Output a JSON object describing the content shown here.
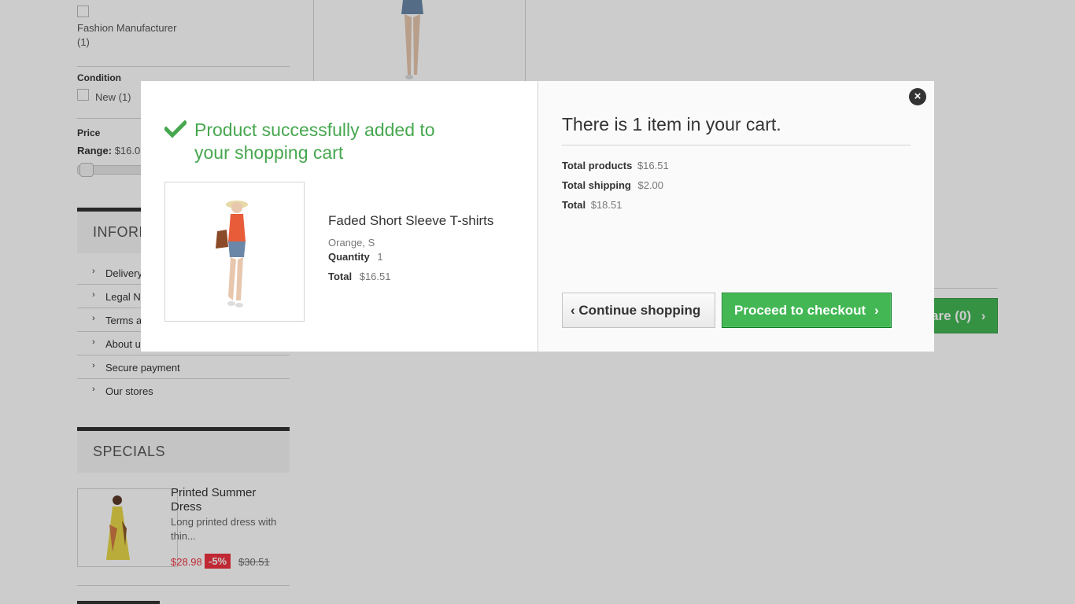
{
  "background": {
    "filters": {
      "manufacturer_label": "Fashion Manufacturer",
      "manufacturer_count": "(1)",
      "condition_title": "Condition",
      "condition_option": "New (1)",
      "price_title": "Price",
      "range_label": "Range:",
      "range_value": "$16.0"
    },
    "information": {
      "title": "INFORM",
      "items": [
        "Delivery",
        "Legal N",
        "Terms a",
        "About u",
        "Secure payment",
        "Our stores"
      ]
    },
    "specials": {
      "title": "SPECIALS",
      "product_name": "Printed Summer Dress",
      "description": "Long printed dress with thin...",
      "price": "$28.98",
      "discount": "-5%",
      "old_price": "$30.51"
    },
    "compare_button": "are (0)"
  },
  "modal": {
    "close_icon": "×",
    "left": {
      "success_message": "Product successfully added to your shopping cart",
      "product_name": "Faded Short Sleeve T-shirts",
      "attributes": "Orange, S",
      "quantity_label": "Quantity",
      "quantity_value": "1",
      "total_label": "Total",
      "total_value": "$16.51"
    },
    "right": {
      "cart_title": "There is 1 item in your cart.",
      "total_products_label": "Total products",
      "total_products_value": "$16.51",
      "total_shipping_label": "Total shipping",
      "total_shipping_value": "$2.00",
      "total_label": "Total",
      "total_value": "$18.51",
      "continue_button": "Continue shopping",
      "checkout_button": "Proceed to checkout"
    }
  },
  "colors": {
    "success_green": "#46a74e",
    "checkout_green": "#43b754",
    "sale_red": "#f13340"
  }
}
